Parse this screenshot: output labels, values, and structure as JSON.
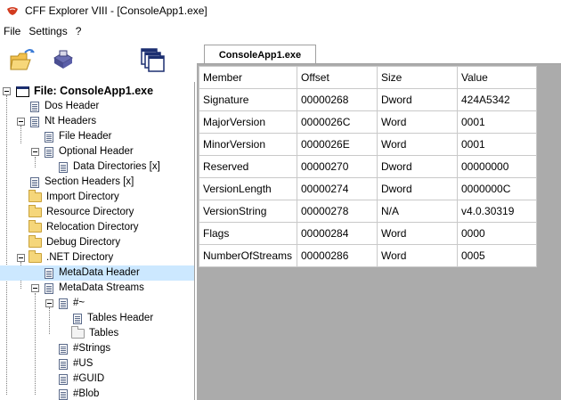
{
  "window": {
    "title": "CFF Explorer VIII - [ConsoleApp1.exe]"
  },
  "menu": [
    "File",
    "Settings",
    "?"
  ],
  "toolbar": {
    "open_icon": "open-folder-icon",
    "save_icon": "save-disk-icon",
    "windows_icon": "windows-icon"
  },
  "tree": {
    "root": "File: ConsoleApp1.exe",
    "items": {
      "dos_header": "Dos Header",
      "nt_headers": "Nt Headers",
      "file_header": "File Header",
      "optional_header": "Optional Header",
      "data_directories": "Data Directories [x]",
      "section_headers": "Section Headers [x]",
      "import_directory": "Import Directory",
      "resource_directory": "Resource Directory",
      "relocation_directory": "Relocation Directory",
      "debug_directory": "Debug Directory",
      "net_directory": ".NET Directory",
      "metadata_header": "MetaData Header",
      "metadata_streams": "MetaData Streams",
      "stream_tilde": "#~",
      "tables_header": "Tables Header",
      "tables": "Tables",
      "stream_strings": "#Strings",
      "stream_us": "#US",
      "stream_guid": "#GUID",
      "stream_blob": "#Blob"
    }
  },
  "tab": {
    "label": "ConsoleApp1.exe"
  },
  "grid": {
    "headers": [
      "Member",
      "Offset",
      "Size",
      "Value"
    ],
    "rows": [
      [
        "Signature",
        "00000268",
        "Dword",
        "424A5342"
      ],
      [
        "MajorVersion",
        "0000026C",
        "Word",
        "0001"
      ],
      [
        "MinorVersion",
        "0000026E",
        "Word",
        "0001"
      ],
      [
        "Reserved",
        "00000270",
        "Dword",
        "00000000"
      ],
      [
        "VersionLength",
        "00000274",
        "Dword",
        "0000000C"
      ],
      [
        "VersionString",
        "00000278",
        "N/A",
        "v4.0.30319"
      ],
      [
        "Flags",
        "00000284",
        "Word",
        "0000"
      ],
      [
        "NumberOfStreams",
        "00000286",
        "Word",
        "0005"
      ]
    ]
  },
  "colors": {
    "selection": "#cce8ff",
    "grid_background": "#ababab",
    "title_icon": "#d23b1f"
  }
}
